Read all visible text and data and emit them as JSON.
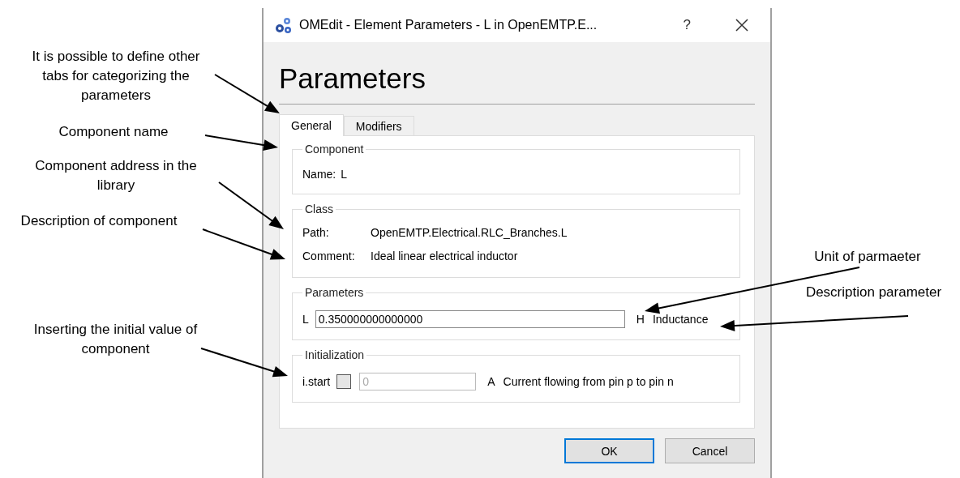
{
  "annotations": [
    {
      "text": "It is possible to define other tabs for categorizing the parameters"
    },
    {
      "text": "Component name"
    },
    {
      "text": "Component address in the library"
    },
    {
      "text": "Description of component"
    },
    {
      "text": "Inserting the initial value of component"
    },
    {
      "text": "Unit of parmaeter"
    },
    {
      "text": "Description parameter"
    }
  ],
  "window": {
    "title": "OMEdit - Element Parameters - L in OpenEMTP.E...",
    "help": "?"
  },
  "heading": "Parameters",
  "tabs": [
    {
      "label": "General",
      "selected": true
    },
    {
      "label": "Modifiers",
      "selected": false
    }
  ],
  "groups": [
    {
      "kind": "info",
      "title": "Component",
      "rows": [
        {
          "label": "Name:",
          "value": "L"
        }
      ]
    },
    {
      "kind": "info",
      "title": "Class",
      "rows": [
        {
          "label": "Path:",
          "value": "OpenEMTP.Electrical.RLC_Branches.L"
        },
        {
          "label": "Comment:",
          "value": "Ideal linear electrical inductor"
        }
      ]
    },
    {
      "kind": "parameter",
      "title": "Parameters",
      "label": "L",
      "value": "0.350000000000000",
      "unit": "H",
      "description": "Inductance"
    },
    {
      "kind": "init",
      "title": "Initialization",
      "label": "i.start",
      "checked": false,
      "placeholder": "0",
      "unit": "A",
      "description": "Current flowing from pin p to pin n"
    }
  ],
  "buttons": [
    {
      "label": "OK",
      "selected": true
    },
    {
      "label": "Cancel",
      "selected": false
    }
  ]
}
